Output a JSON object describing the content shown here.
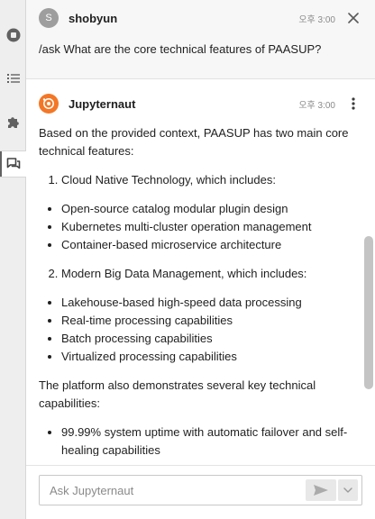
{
  "sidebar": {
    "items": [
      {
        "icon": "stop-circle-icon",
        "label": "Running terminals and kernels"
      },
      {
        "icon": "list-icon",
        "label": "Table of contents"
      },
      {
        "icon": "puzzle-piece-icon",
        "label": "Extension manager"
      },
      {
        "icon": "chat-icon",
        "label": "Jupyternaut chat"
      }
    ]
  },
  "human_message": {
    "avatar_initial": "S",
    "author": "shobyun",
    "time": "오후 3:00",
    "text": "/ask What are the core technical features of PAASUP?"
  },
  "ai_message": {
    "author": "Jupyternaut",
    "time": "오후 3:00",
    "intro": "Based on the provided context, PAASUP has two main core technical features:",
    "section1_title": "Cloud Native Technology, which includes:",
    "section1_items": [
      "Open-source catalog modular plugin design",
      "Kubernetes multi-cluster operation management",
      "Container-based microservice architecture"
    ],
    "section2_title": "Modern Big Data Management, which includes:",
    "section2_items": [
      "Lakehouse-based high-speed data processing",
      "Real-time processing capabilities",
      "Batch processing capabilities",
      "Virtualized processing capabilities"
    ],
    "outro": "The platform also demonstrates several key technical capabilities:",
    "capabilities": [
      "99.99% system uptime with automatic failover and self-healing capabilities"
    ]
  },
  "input": {
    "placeholder": "Ask Jupyternaut",
    "value": ""
  },
  "colors": {
    "accent_orange": "#f37726",
    "sidebar_bg": "#eeeeee",
    "human_msg_bg": "#f7f7f7"
  }
}
